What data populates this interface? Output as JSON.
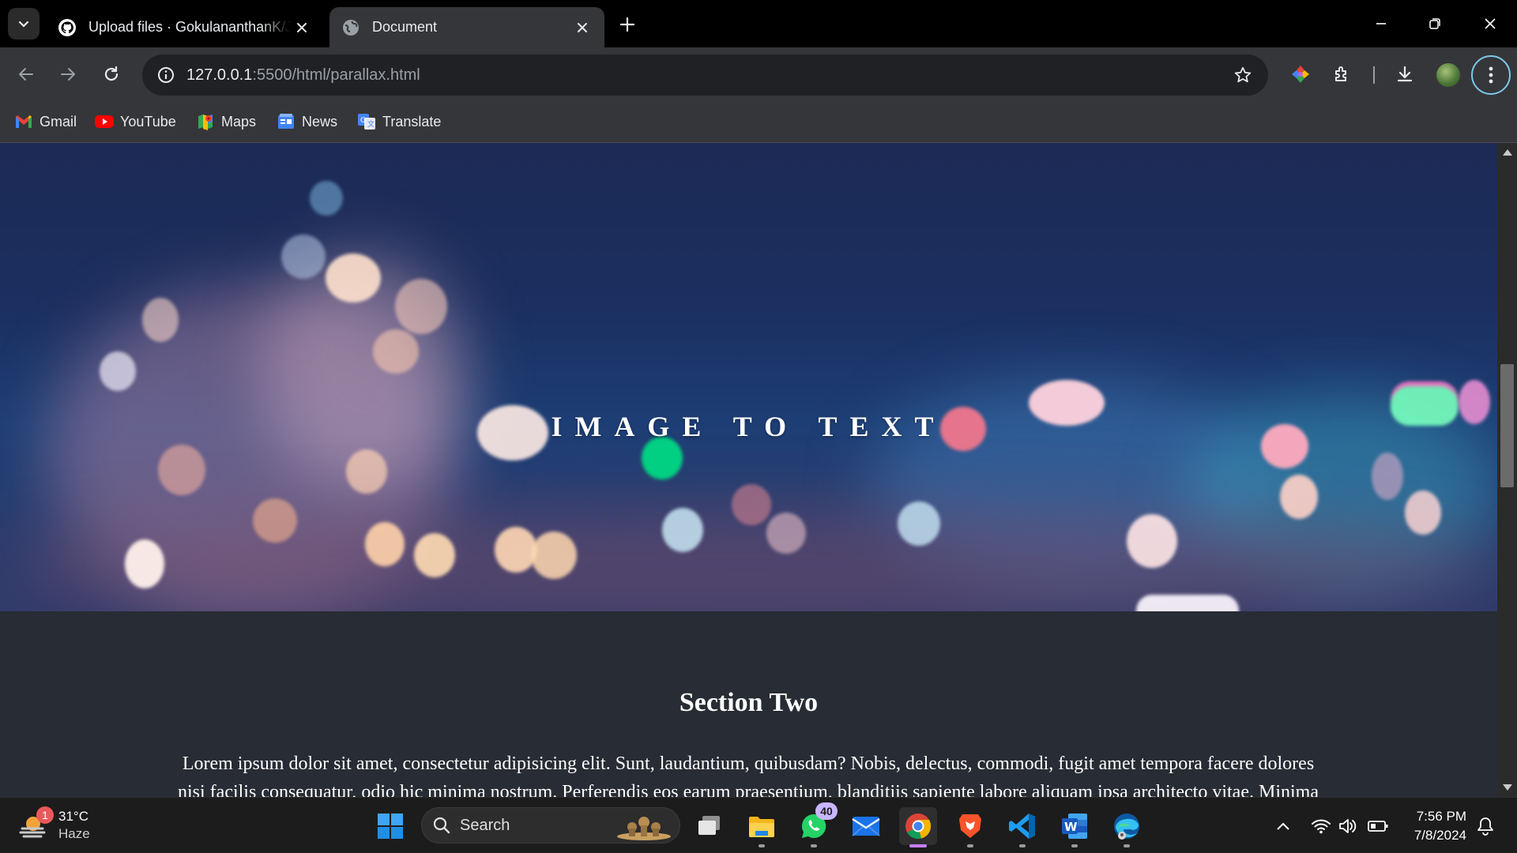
{
  "tabs": [
    {
      "title": "Upload files · GokulananthanK/Java-Script-Projects",
      "favicon": "github-icon",
      "active": false
    },
    {
      "title": "Document",
      "favicon": "globe-icon",
      "active": true
    }
  ],
  "toolbar": {
    "url_host": "127.0.0.1",
    "url_path": ":5500/html/parallax.html"
  },
  "bookmarks": [
    {
      "label": "Gmail",
      "icon": "gmail-icon"
    },
    {
      "label": "YouTube",
      "icon": "youtube-icon"
    },
    {
      "label": "Maps",
      "icon": "maps-icon"
    },
    {
      "label": "News",
      "icon": "news-icon"
    },
    {
      "label": "Translate",
      "icon": "translate-icon"
    }
  ],
  "page": {
    "hero_title": "IMAGE TO TEXT",
    "section_title": "Section Two",
    "section_text": "Lorem ipsum dolor sit amet, consectetur adipisicing elit. Sunt, laudantium, quibusdam? Nobis, delectus, commodi, fugit amet tempora facere dolores nisi facilis consequatur, odio hic minima nostrum. Perferendis eos earum praesentium, blanditiis sapiente labore aliquam ipsa architecto vitae. Minima"
  },
  "taskbar": {
    "weather_temp": "31°C",
    "weather_cond": "Haze",
    "weather_badge": "1",
    "search_label": "Search",
    "whatsapp_badge": "40",
    "time": "7:56 PM",
    "date": "7/8/2024"
  },
  "colors": {
    "accent": "#7cc9e6",
    "tab_active": "#35363a",
    "page_bg": "#282c34"
  }
}
